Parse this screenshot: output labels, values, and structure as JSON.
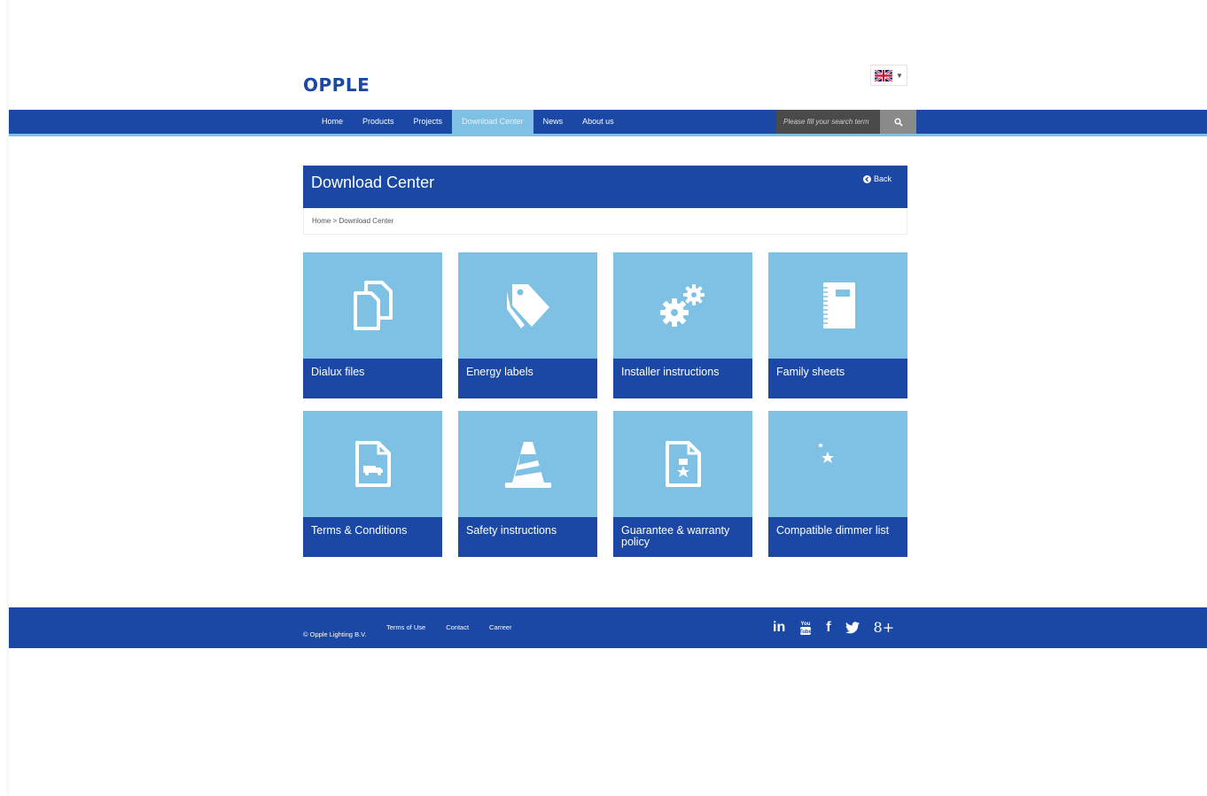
{
  "header": {
    "logo_text": "OPPLE",
    "language": "flag-uk-icon"
  },
  "nav": {
    "items": [
      {
        "label": "Home"
      },
      {
        "label": "Products"
      },
      {
        "label": "Projects"
      },
      {
        "label": "Download Center",
        "active": true
      },
      {
        "label": "News"
      },
      {
        "label": "About us"
      }
    ],
    "search_placeholder": "Please fill your search term",
    "search_icon": "search-icon"
  },
  "page": {
    "title": "Download Center",
    "back_label": "Back",
    "breadcrumb": [
      "Home",
      ">",
      "Download Center"
    ]
  },
  "tiles": [
    {
      "label": "Dialux files",
      "icon": "documents-icon"
    },
    {
      "label": "Energy labels",
      "icon": "tags-icon"
    },
    {
      "label": "Installer instructions",
      "icon": "gears-icon"
    },
    {
      "label": "Family sheets",
      "icon": "notebook-icon"
    },
    {
      "label": "Terms & Conditions",
      "icon": "truck-document-icon"
    },
    {
      "label": "Safety instructions",
      "icon": "traffic-cone-icon"
    },
    {
      "label": "Guarantee & warranty policy",
      "icon": "certificate-document-icon"
    },
    {
      "label": "Compatible dimmer list",
      "icon": "moon-star-icon"
    }
  ],
  "footer": {
    "copyright": "© Opple Lighting B.V.",
    "links": [
      "Terms of Use",
      "Contact",
      "Carreer"
    ],
    "social": [
      "in",
      "YouTube",
      "f",
      "twitter",
      "8+"
    ]
  },
  "colors": {
    "brand_blue": "#1b48a4",
    "light_blue": "#7fc1e4"
  }
}
